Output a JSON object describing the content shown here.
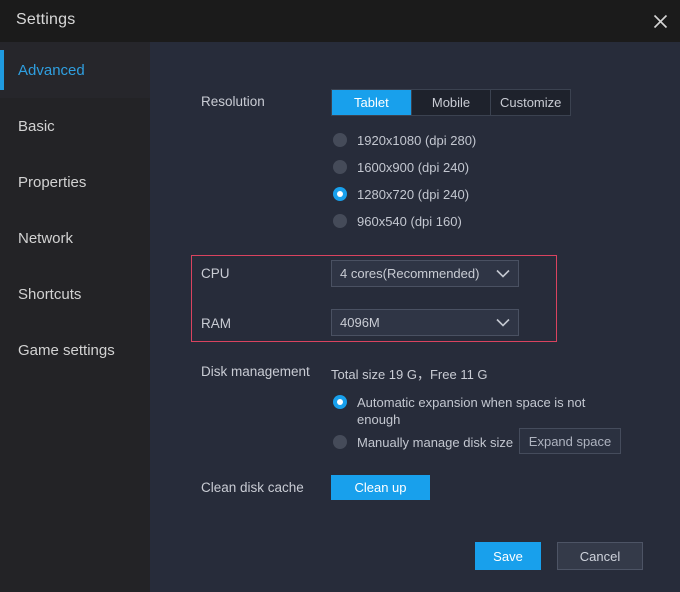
{
  "window": {
    "title": "Settings",
    "close_icon": "close-icon"
  },
  "sidebar": {
    "items": [
      {
        "label": "Advanced",
        "active": true
      },
      {
        "label": "Basic",
        "active": false
      },
      {
        "label": "Properties",
        "active": false
      },
      {
        "label": "Network",
        "active": false
      },
      {
        "label": "Shortcuts",
        "active": false
      },
      {
        "label": "Game settings",
        "active": false
      }
    ]
  },
  "colors": {
    "accent": "#18a0ec",
    "sidebar_active_text": "#2f9fe0",
    "highlight_box": "#d9435f",
    "content_bg": "#272c3a",
    "sidebar_bg": "#232326",
    "titlebar_bg": "#1b1b1b"
  },
  "main": {
    "resolution": {
      "label": "Resolution",
      "tabs": [
        {
          "label": "Tablet",
          "active": true
        },
        {
          "label": "Mobile",
          "active": false
        },
        {
          "label": "Customize",
          "active": false
        }
      ],
      "options": [
        {
          "label": "1920x1080  (dpi 280)",
          "selected": false
        },
        {
          "label": "1600x900  (dpi 240)",
          "selected": false
        },
        {
          "label": "1280x720  (dpi 240)",
          "selected": true
        },
        {
          "label": "960x540  (dpi 160)",
          "selected": false
        }
      ]
    },
    "cpu": {
      "label": "CPU",
      "value": "4 cores(Recommended)",
      "arrow_icon": "chevron-down-icon"
    },
    "ram": {
      "label": "RAM",
      "value": "4096M",
      "arrow_icon": "chevron-down-icon"
    },
    "disk": {
      "label": "Disk management",
      "summary": "Total size 19 G，Free 11 G",
      "options": [
        {
          "label": "Automatic expansion when space is not enough",
          "selected": true
        },
        {
          "label": "Manually manage disk size",
          "selected": false
        }
      ],
      "expand_button": "Expand space"
    },
    "clean_cache": {
      "label": "Clean disk cache",
      "button": "Clean up"
    }
  },
  "footer": {
    "save": "Save",
    "cancel": "Cancel"
  }
}
